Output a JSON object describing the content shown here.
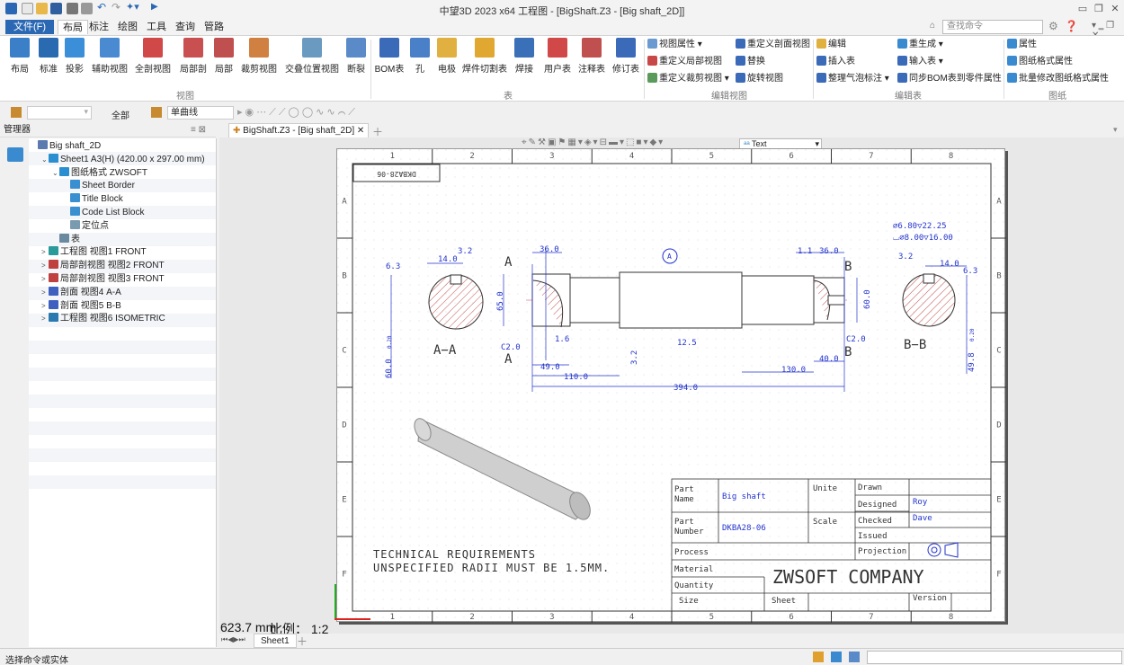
{
  "window": {
    "title": "中望3D 2023 x64      工程图 - [BigShaft.Z3 - [Big shaft_2D]]"
  },
  "menu": {
    "file": "文件(F)",
    "items": [
      "布局",
      "标注",
      "绘图",
      "工具",
      "查询",
      "管路"
    ]
  },
  "search": {
    "placeholder": "查找命令"
  },
  "ribbon": {
    "view_buttons": [
      "布局",
      "标准",
      "投影",
      "辅助视图",
      "全剖视图",
      "局部剖",
      "局部",
      "裁剪视图",
      "交叠位置视图",
      "断裂"
    ],
    "view_group": "视图",
    "table_buttons": [
      "BOM表",
      "孔",
      "电极",
      "焊件切割表",
      "焊接",
      "用户表",
      "注释表",
      "修订表"
    ],
    "table_group": "表",
    "editview_items": [
      "视图属性",
      "重定义剖面视图",
      "重定义局部视图",
      "替换",
      "重定义裁剪视图",
      "旋转视图"
    ],
    "editview_group": "编辑视图",
    "edittable_items": [
      "编辑",
      "重生成",
      "插入表",
      "输入表",
      "整理气泡标注",
      "同步BOM表到零件属性"
    ],
    "edittable_group": "编辑表",
    "sheet_items": [
      "属性",
      "图纸格式属性",
      "批量修改图纸格式属性"
    ],
    "sheet_group": "图纸"
  },
  "toolbar2": {
    "filter": "全部",
    "linetype": "单曲线"
  },
  "manager": {
    "title": "管理器",
    "tree": [
      {
        "label": "Big shaft_2D",
        "indent": 0,
        "arrow": "",
        "color": "#5a7ab0"
      },
      {
        "label": "Sheet1 A3(H) (420.00 x 297.00 mm)",
        "indent": 1,
        "arrow": "⌄",
        "color": "#2a8fd0"
      },
      {
        "label": "图纸格式 ZWSOFT",
        "indent": 2,
        "arrow": "⌄",
        "color": "#2a8fd0"
      },
      {
        "label": "Sheet Border",
        "indent": 3,
        "arrow": "",
        "color": "#3a8fd0"
      },
      {
        "label": "Title Block",
        "indent": 3,
        "arrow": "",
        "color": "#3a8fd0"
      },
      {
        "label": "Code List Block",
        "indent": 3,
        "arrow": "",
        "color": "#3a8fd0"
      },
      {
        "label": "定位点",
        "indent": 3,
        "arrow": "",
        "color": "#7a9ab0"
      },
      {
        "label": "表",
        "indent": 2,
        "arrow": "",
        "color": "#6a8aa0"
      },
      {
        "label": "工程图 视图1 FRONT",
        "indent": 1,
        "arrow": ">",
        "color": "#2a9a9a"
      },
      {
        "label": "局部剖视图 视图2 FRONT",
        "indent": 1,
        "arrow": ">",
        "color": "#c04040"
      },
      {
        "label": "局部剖视图 视图3 FRONT",
        "indent": 1,
        "arrow": ">",
        "color": "#c04040"
      },
      {
        "label": "剖面 视图4 A-A",
        "indent": 1,
        "arrow": ">",
        "color": "#4060c0"
      },
      {
        "label": "剖面 视图5 B-B",
        "indent": 1,
        "arrow": ">",
        "color": "#4060c0"
      },
      {
        "label": "工程图 视图6 ISOMETRIC",
        "indent": 1,
        "arrow": ">",
        "color": "#2a7ab0"
      }
    ]
  },
  "document": {
    "tab": "BigShaft.Z3 - [Big shaft_2D]",
    "text_style": "Text"
  },
  "drawing": {
    "stamp": "DKBA28-06",
    "col_labels": [
      "1",
      "2",
      "3",
      "4",
      "5",
      "6",
      "7",
      "8"
    ],
    "row_labels": [
      "A",
      "B",
      "C",
      "D",
      "E",
      "F"
    ],
    "dims": [
      "36.0",
      "14.0",
      "6.3",
      "3.2",
      "65.0",
      "C2.0",
      "1.6",
      "49.0",
      "110.0",
      "394.0",
      "12.5",
      "3.2",
      "130.0",
      "1.1",
      "36.0",
      "40.0",
      "60.0",
      "C2.0",
      "3.2",
      "14.0",
      "6.3",
      "60.0",
      "49.8",
      "⌀6.80▽22.25",
      "⌴⌀8.00▽16.00"
    ],
    "section_aa": "A−A",
    "section_bb": "B−B",
    "tol_aa": "0.20",
    "tol_bb": "0.20",
    "datum": "A",
    "cut_a": "A",
    "cut_b": "B",
    "tech_req_1": "TECHNICAL  REQUIREMENTS",
    "tech_req_2": "UNSPECIFIED  RADII  MUST  BE  1.5MM."
  },
  "titleblock": {
    "part_name_label": "Part\nName",
    "part_name": "Big shaft",
    "unite_label": "Unite",
    "scale_label": "Scale",
    "drawn": "Drawn",
    "designed": "Designed",
    "designed_by": "Roy",
    "checked": "Checked",
    "checked_by": "Dave",
    "issued": "Issued",
    "part_number_label": "Part\nNumber",
    "part_number": "DKBA28-06",
    "process": "Process",
    "projection": "Projection",
    "material": "Material",
    "quantity": "Quantity",
    "size": "Size",
    "sheet": "Sheet",
    "version": "Version",
    "company": "ZWSOFT  COMPANY"
  },
  "overlay": {
    "coord": "623.7 mm",
    "scale": "比例： 1:2"
  },
  "sheets": {
    "tab": "Sheet1"
  },
  "status": {
    "text": "选择命令或实体"
  },
  "colors": {
    "dim_blue": "#2233cc",
    "accent": "#2b68b4",
    "section_hatch": "#b02020"
  }
}
